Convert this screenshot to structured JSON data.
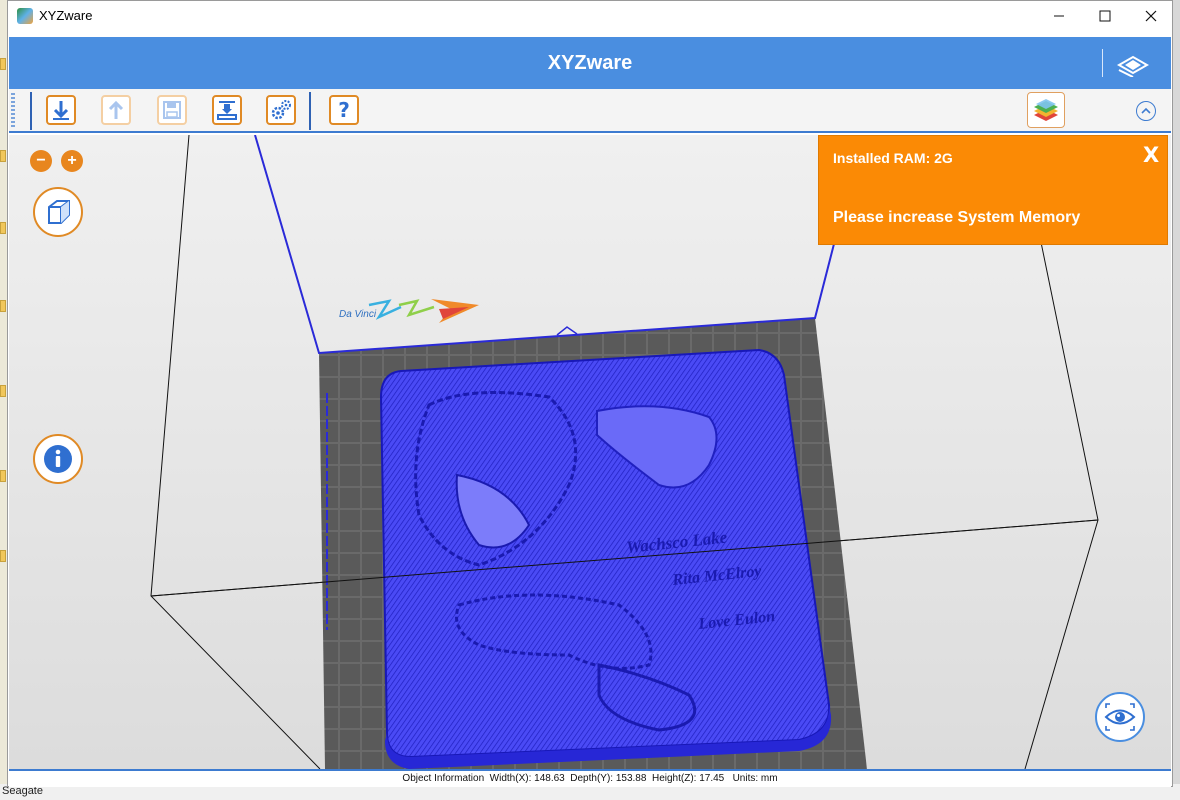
{
  "window": {
    "title": "XYZware"
  },
  "header": {
    "title": "XYZware"
  },
  "toolbar": {
    "buttons": [
      {
        "id": "import",
        "icon": "import-down-arrow-icon",
        "enabled": true
      },
      {
        "id": "export",
        "icon": "export-up-arrow-icon",
        "enabled": false
      },
      {
        "id": "save",
        "icon": "save-disk-icon",
        "enabled": false
      },
      {
        "id": "print",
        "icon": "printer-icon",
        "enabled": true
      },
      {
        "id": "settings",
        "icon": "gears-icon",
        "enabled": true
      },
      {
        "id": "help",
        "icon": "question-mark-icon",
        "enabled": true,
        "label": "?"
      }
    ]
  },
  "viewport": {
    "zoom_out_label": "−",
    "zoom_in_label": "+",
    "model_text_lines": [
      "Wachsco Lake",
      "Rita McElroy",
      "Love Eulon"
    ],
    "logo_text": "Da Vinci"
  },
  "notification": {
    "line1": "Installed RAM: 2G",
    "line2": "Please increase System Memory",
    "close_label": "X"
  },
  "status": {
    "text": "Object Information  Width(X): 148.63  Depth(Y): 153.88  Height(Z): 17.45   Units: mm",
    "width_x": 148.63,
    "depth_y": 153.88,
    "height_z": 17.45,
    "units": "mm"
  },
  "desktop": {
    "taskbar_text": "Seagate"
  },
  "colors": {
    "accent_blue": "#4a8ee0",
    "toolbar_orange": "#e08a25",
    "alert_orange": "#fb8a05",
    "model_blue": "#3a3af0"
  }
}
